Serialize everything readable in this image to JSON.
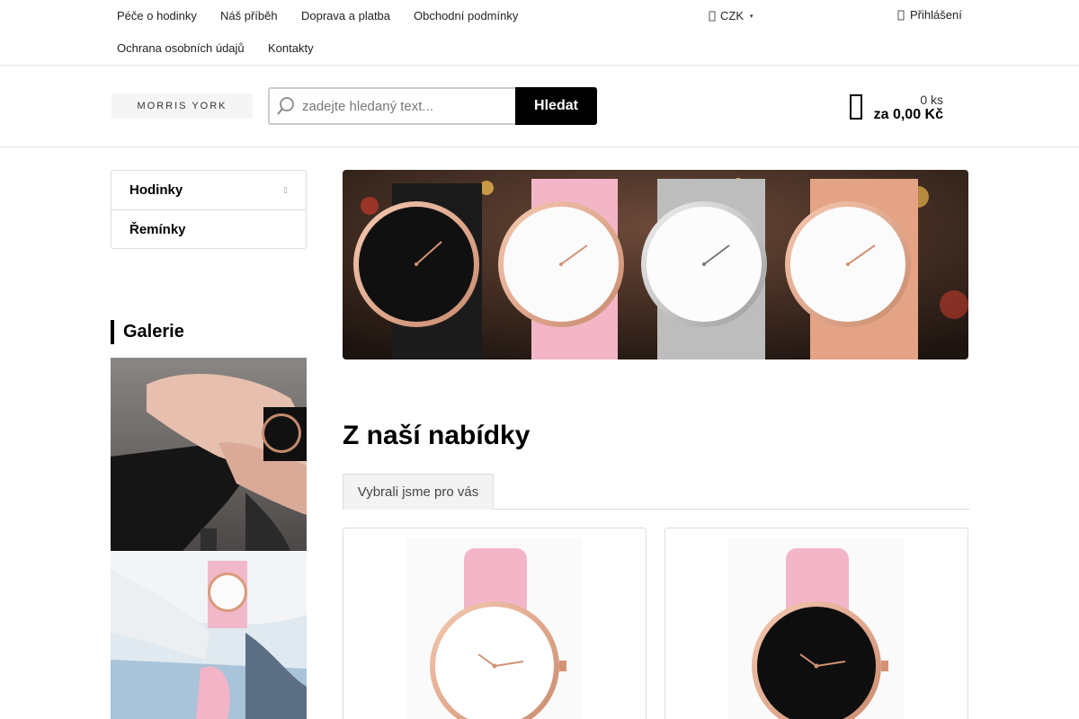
{
  "topnav": {
    "links": [
      "Péče o hodinky",
      "Náš příběh",
      "Doprava a platba",
      "Obchodní podmínky",
      "Ochrana osobních údajů",
      "Kontakty"
    ],
    "currency": "CZK",
    "login": "Přihlášení"
  },
  "header": {
    "logo_text": "MORRIS YORK",
    "search_placeholder": "zadejte hledaný text...",
    "search_button": "Hledat",
    "cart": {
      "count": "0 ks",
      "total": "za 0,00 Kč"
    }
  },
  "sidebar": {
    "categories": [
      "Hodinky",
      "Řemínky"
    ],
    "gallery_title": "Galerie"
  },
  "main": {
    "section_title": "Z naší nabídky",
    "tabs": [
      "Vybrali jsme pro vás"
    ]
  },
  "icons": {
    "search": "search-icon",
    "cart": "shopping-bag-icon",
    "login": "user-icon",
    "chevron": "chevron-right-icon",
    "currency": "currency-icon"
  },
  "colors": {
    "accent": "#000000",
    "border": "#dddddd",
    "tab_bg": "#f3f3f3",
    "text": "#222222"
  }
}
